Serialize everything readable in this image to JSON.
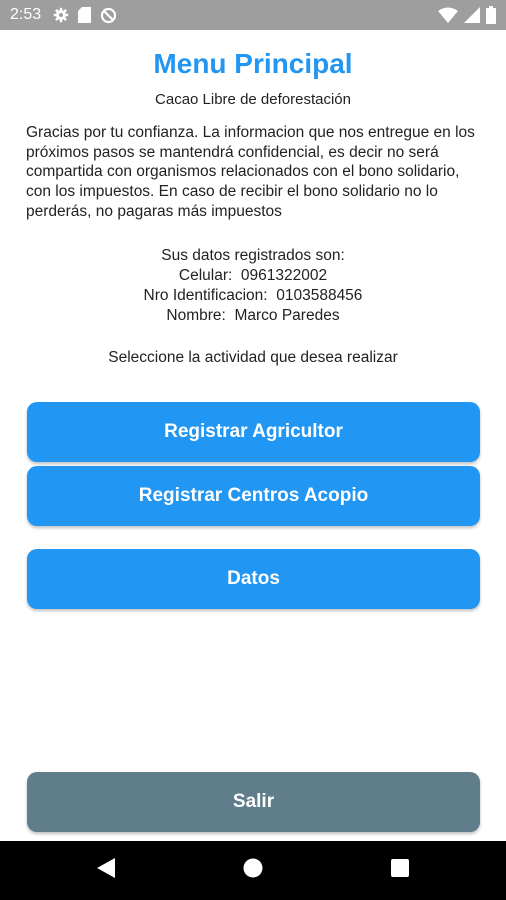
{
  "status_bar": {
    "time": "2:53",
    "icons": [
      "gear-icon",
      "sd-card-icon",
      "no-sync-icon",
      "wifi-icon",
      "signal-icon",
      "battery-icon"
    ]
  },
  "header": {
    "title": "Menu Principal",
    "subtitle": "Cacao Libre de deforestación"
  },
  "info_paragraph": "Gracias por tu confianza. La informacion que nos entregue en los próximos pasos se mantendrá confidencial, es decir no será compartida con organismos relacionados con el bono solidario, con los impuestos. En caso de recibir el bono solidario no lo perderás, no pagaras más impuestos",
  "registered": {
    "heading": "Sus datos registrados son:",
    "phone_line": "Celular:  0961322002",
    "id_line": "Nro Identificacion:  0103588456",
    "name_line": "Nombre:  Marco Paredes"
  },
  "instruction": "Seleccione la actividad que desea realizar",
  "buttons": {
    "register_farmer": "Registrar Agricultor",
    "register_centers": "Registrar Centros Acopio",
    "data": "Datos",
    "exit": "Salir"
  },
  "colors": {
    "primary": "#2196f3",
    "secondary": "#607d8b",
    "status_bar": "#9e9e9e",
    "nav_bar": "#000000"
  },
  "nav_bar": {
    "icons": [
      "back-icon",
      "home-icon",
      "recents-icon"
    ]
  }
}
